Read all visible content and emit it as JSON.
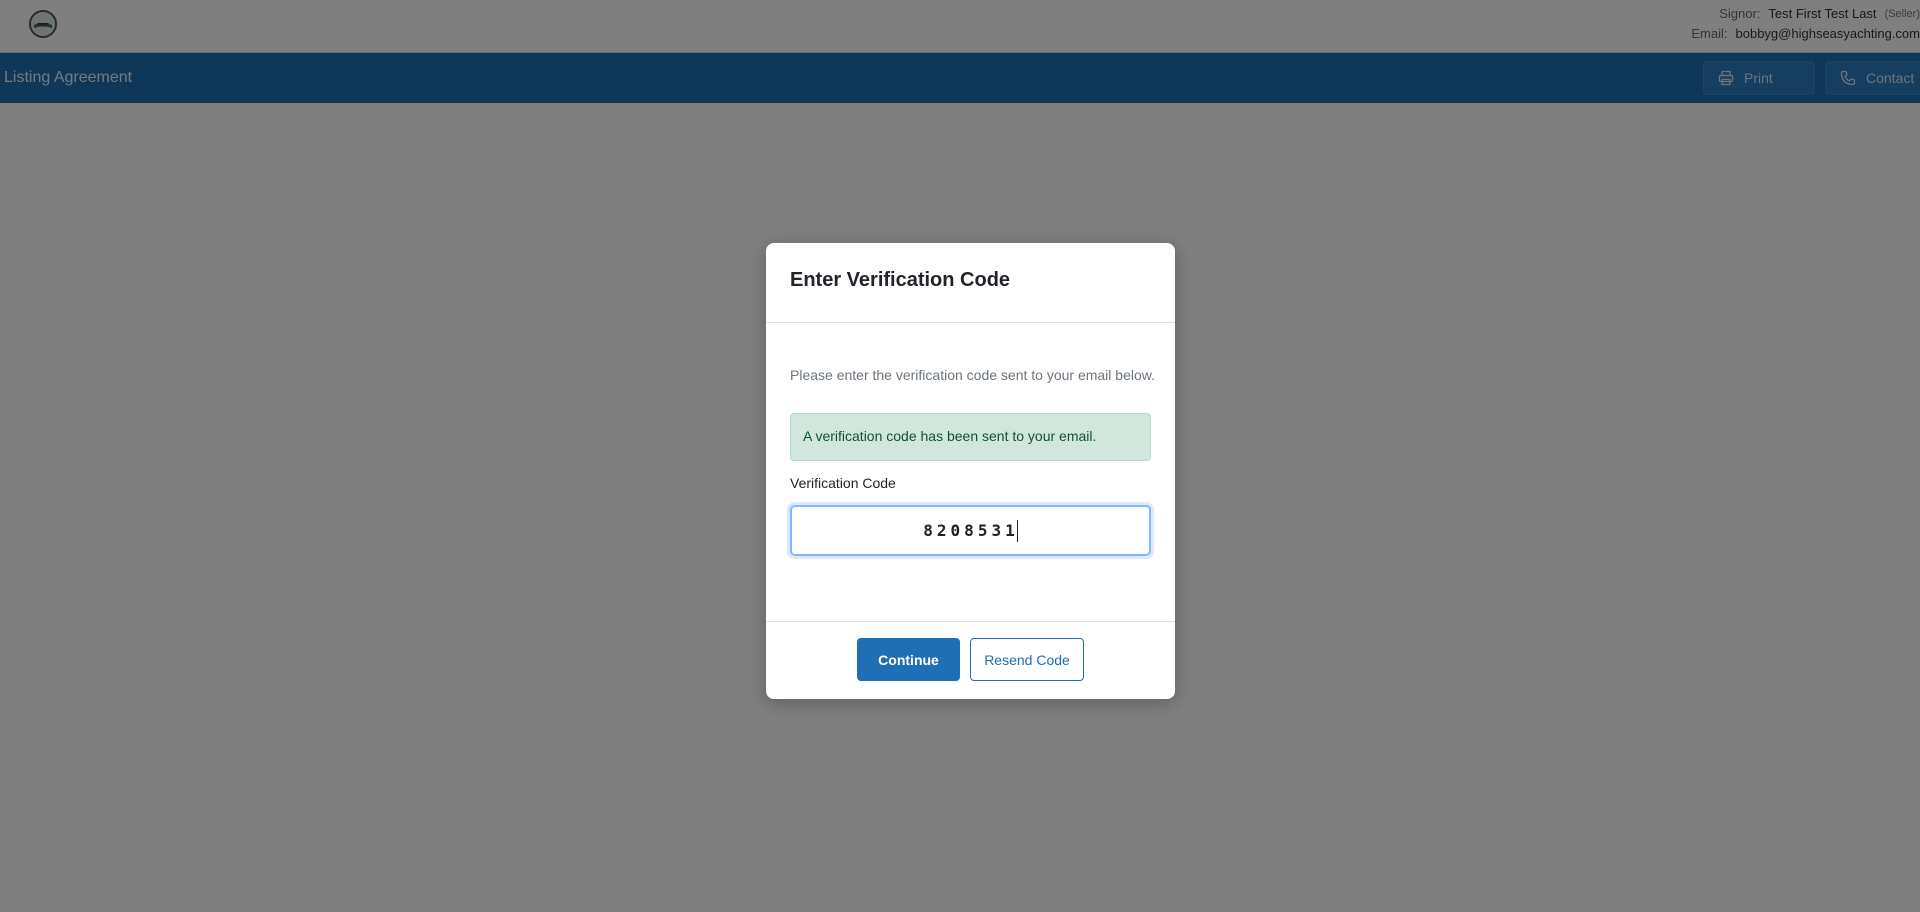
{
  "header": {
    "logo_icon": "club-logo-icon",
    "signor_label": "Signor:",
    "signor_name": "Test First Test Last",
    "signor_role": "(Seller)",
    "email_label": "Email:",
    "email_value": "bobbyg@highseasyachting.com"
  },
  "navbar": {
    "document_title": "Listing Agreement",
    "print_label": "Print",
    "print_icon": "printer-icon",
    "contact_label": "Contact",
    "contact_icon": "phone-icon",
    "background_color": "#1f6fb4"
  },
  "modal": {
    "title": "Enter Verification Code",
    "instructions": "Please enter the verification code sent to your email below.",
    "alert_text": "A verification code has been sent to your email.",
    "field_label": "Verification Code",
    "code_value": "8208531",
    "continue_label": "Continue",
    "resend_label": "Resend Code",
    "accent_color": "#1f6fb4",
    "alert_color": "#d1e7dd"
  }
}
